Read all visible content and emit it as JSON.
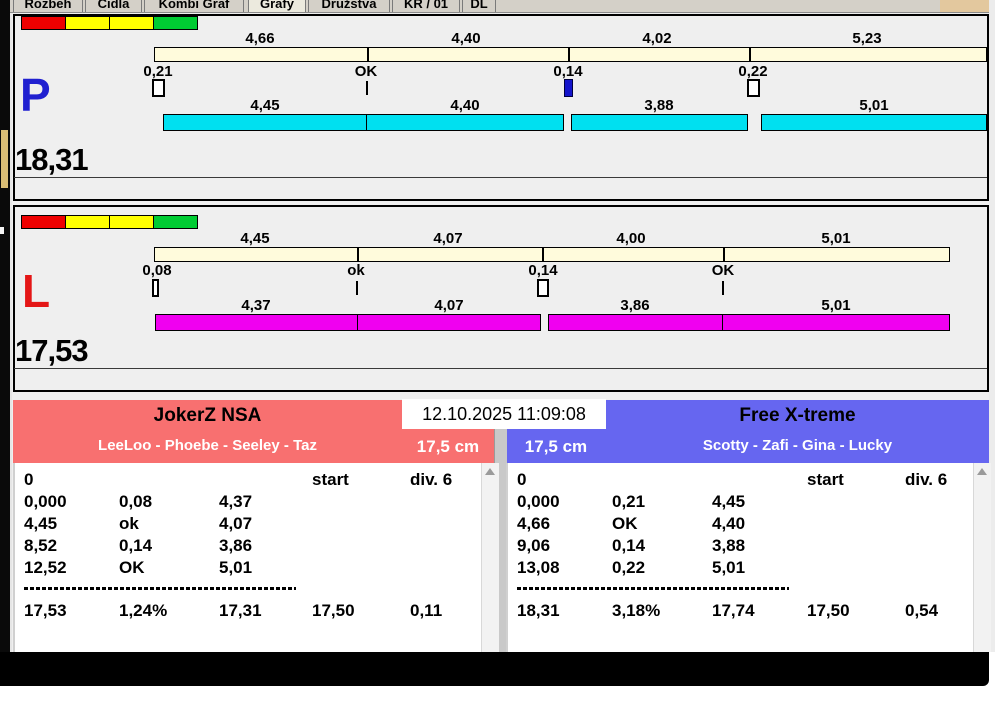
{
  "window": {
    "tabs": [
      {
        "label": "Rozbeh"
      },
      {
        "label": "Cidla"
      },
      {
        "label": "Kombi Graf"
      },
      {
        "label": "Grafy"
      },
      {
        "label": "Družstva"
      },
      {
        "label": "KR / 01"
      },
      {
        "label": "DL"
      }
    ],
    "active_tab": "Grafy"
  },
  "colors": {
    "lane_p_bar": "#00e0f0",
    "lane_l_bar": "#f000f0",
    "cream_bar": "#fffbdc",
    "team_left_bg": "#f87070",
    "team_right_bg": "#6666f0",
    "status_red": "#ee0000",
    "status_yellow": "#ffff00",
    "status_green": "#00cc33",
    "marker_blue": "#1414cc"
  },
  "lane_p": {
    "letter": "P",
    "total": "18,31",
    "top_segments": [
      "4,66",
      "4,40",
      "4,02",
      "5,23"
    ],
    "markers": [
      "0,21",
      "OK",
      "0,14",
      "0,22"
    ],
    "bottom_segments": [
      "4,45",
      "4,40",
      "3,88",
      "5,01"
    ]
  },
  "lane_l": {
    "letter": "L",
    "total": "17,53",
    "top_segments": [
      "4,45",
      "4,07",
      "4,00",
      "5,01"
    ],
    "markers": [
      "0,08",
      "ok",
      "0,14",
      "OK"
    ],
    "bottom_segments": [
      "4,37",
      "4,07",
      "3,86",
      "5,01"
    ]
  },
  "datetime": "12.10.2025 11:09:08",
  "team_left": {
    "name": "JokerZ NSA",
    "dogs": "LeeLoo - Phoebe - Seeley - Taz",
    "height": "17,5 cm",
    "run": {
      "row0": {
        "c1": "0",
        "start": "start",
        "div": "div. 6"
      },
      "rows": [
        [
          "0,000",
          "0,08",
          "4,37"
        ],
        [
          "4,45",
          "ok",
          "4,07"
        ],
        [
          "8,52",
          "0,14",
          "3,86"
        ],
        [
          "12,52",
          "OK",
          "5,01"
        ]
      ],
      "totals": [
        "17,53",
        "1,24%",
        "17,31",
        "17,50",
        "0,11"
      ]
    }
  },
  "team_right": {
    "name": "Free X-treme",
    "dogs": "Scotty - Zafi - Gina - Lucky",
    "height": "17,5 cm",
    "run": {
      "row0": {
        "c1": "0",
        "start": "start",
        "div": "div. 6"
      },
      "rows": [
        [
          "0,000",
          "0,21",
          "4,45"
        ],
        [
          "4,66",
          "OK",
          "4,40"
        ],
        [
          "9,06",
          "0,14",
          "3,88"
        ],
        [
          "13,08",
          "0,22",
          "5,01"
        ]
      ],
      "totals": [
        "18,31",
        "3,18%",
        "17,74",
        "17,50",
        "0,54"
      ]
    }
  }
}
